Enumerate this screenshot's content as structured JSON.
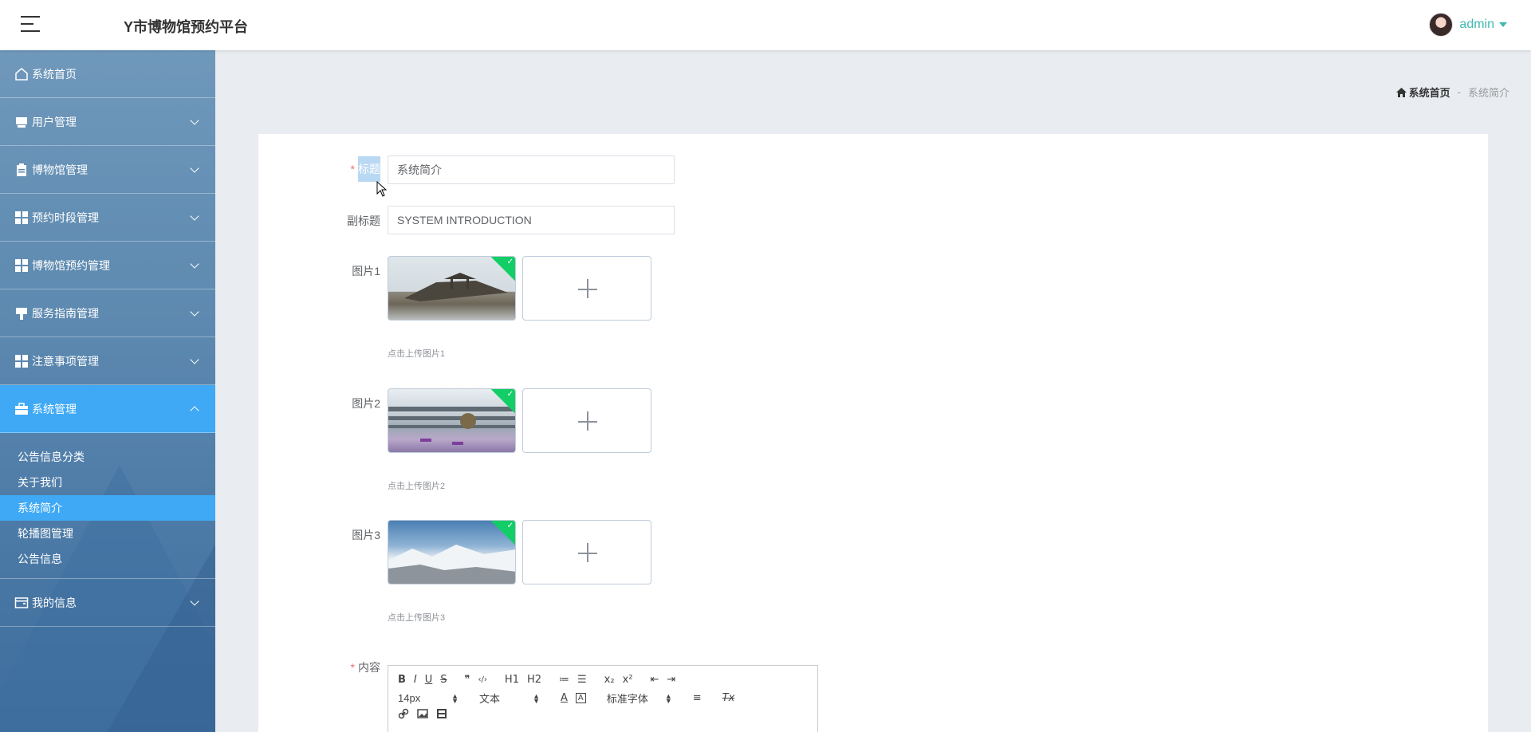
{
  "app": {
    "title": "Y市博物馆预约平台"
  },
  "user": {
    "name": "admin"
  },
  "sidebar": {
    "items": [
      {
        "label": "系统首页"
      },
      {
        "label": "用户管理"
      },
      {
        "label": "博物馆管理"
      },
      {
        "label": "预约时段管理"
      },
      {
        "label": "博物馆预约管理"
      },
      {
        "label": "服务指南管理"
      },
      {
        "label": "注意事项管理"
      },
      {
        "label": "系统管理"
      },
      {
        "label": "我的信息"
      }
    ],
    "submenu": [
      {
        "label": "公告信息分类"
      },
      {
        "label": "关于我们"
      },
      {
        "label": "系统简介"
      },
      {
        "label": "轮播图管理"
      },
      {
        "label": "公告信息"
      }
    ]
  },
  "breadcrumb": {
    "home": "系统首页",
    "separator": "-",
    "current": "系统简介"
  },
  "form": {
    "title_label": "标题",
    "title_value": "系统简介",
    "subtitle_label": "副标题",
    "subtitle_value": "SYSTEM INTRODUCTION",
    "images": [
      {
        "label": "图片1",
        "tip": "点击上传图片1"
      },
      {
        "label": "图片2",
        "tip": "点击上传图片2"
      },
      {
        "label": "图片3",
        "tip": "点击上传图片3"
      }
    ],
    "content_label": "内容",
    "required_mark": "*"
  },
  "editor": {
    "row1": [
      "B",
      "I",
      "U",
      "S",
      "❞",
      "‹/›",
      "H1",
      "H2",
      "≔",
      "☰",
      "x₂",
      "x²",
      "⇤",
      "⇥"
    ],
    "font_size": "14px",
    "block_type": "文本",
    "font_family": "标准字体",
    "color_btn": "A",
    "bg_btn": "A",
    "align_btn": "≡",
    "clear_btn": "Tx"
  },
  "colors": {
    "accent": "#3fa9f5",
    "teal": "#3fb8b0",
    "success": "#13ce66"
  }
}
